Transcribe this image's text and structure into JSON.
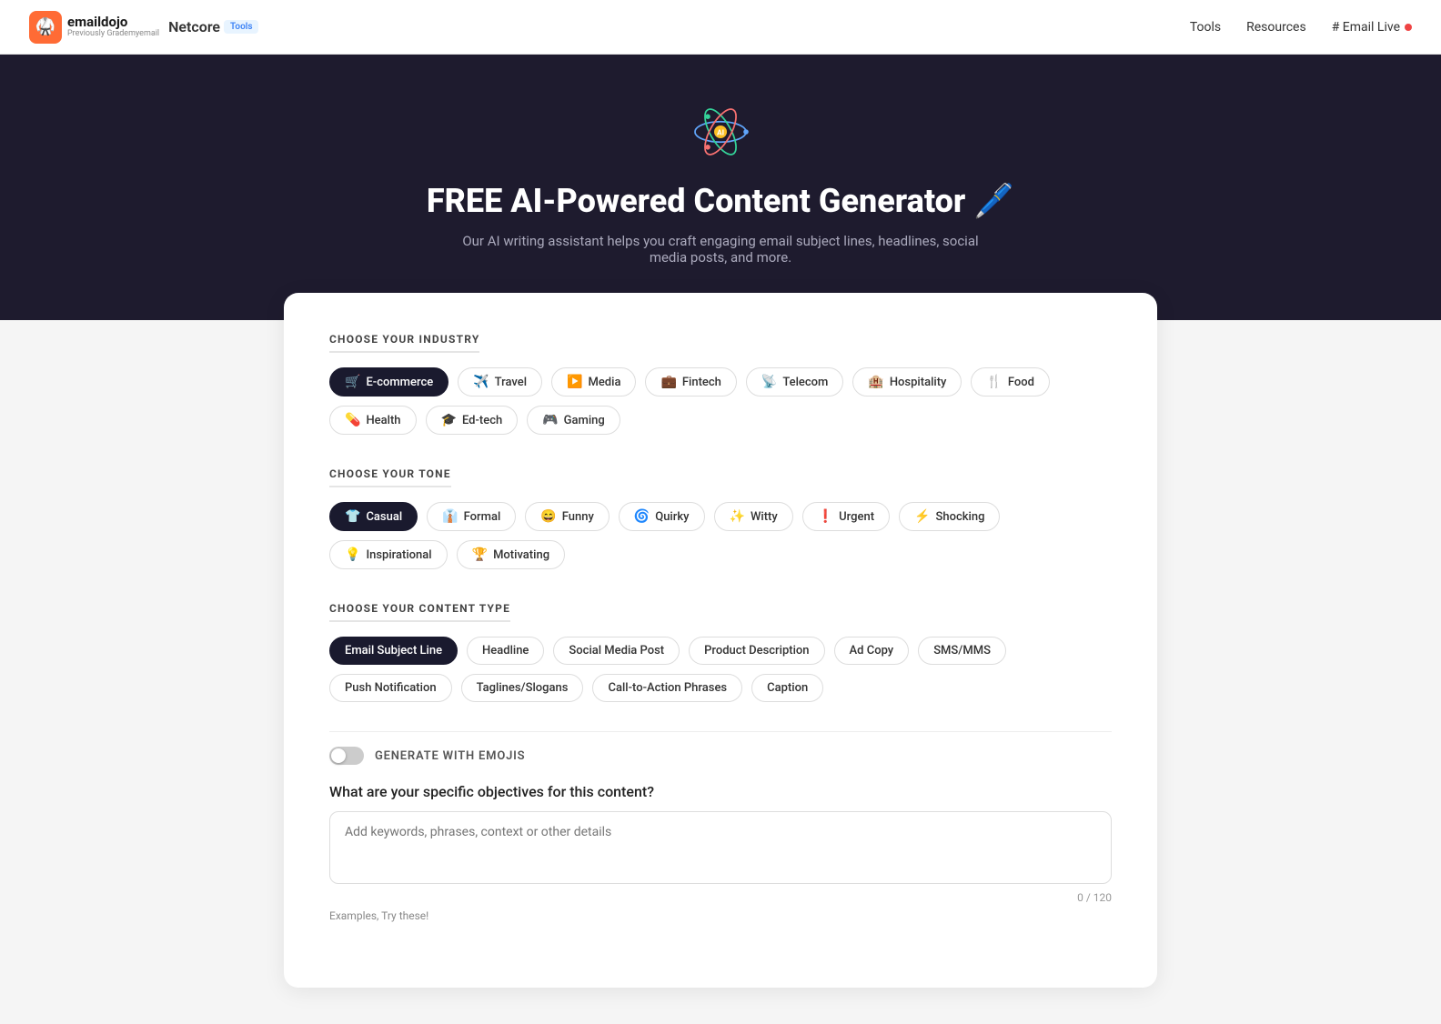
{
  "nav": {
    "logo_main": "emaildojo",
    "logo_sub": "Previously Grademyemail",
    "netcore_text": "Netcore",
    "tools_badge": "Tools",
    "links": [
      "Tools",
      "Resources"
    ],
    "email_live": "# Email Live"
  },
  "hero": {
    "title": "FREE AI-Powered Content Generator 🖊️",
    "subtitle": "Our AI writing assistant helps you craft engaging email subject lines, headlines, social media posts, and more."
  },
  "industry": {
    "label": "CHOOSE YOUR INDUSTRY",
    "items": [
      {
        "icon": "🛒",
        "label": "E-commerce",
        "active": true
      },
      {
        "icon": "✈️",
        "label": "Travel",
        "active": false
      },
      {
        "icon": "▶️",
        "label": "Media",
        "active": false
      },
      {
        "icon": "💼",
        "label": "Fintech",
        "active": false
      },
      {
        "icon": "📡",
        "label": "Telecom",
        "active": false
      },
      {
        "icon": "🏨",
        "label": "Hospitality",
        "active": false
      },
      {
        "icon": "🍴",
        "label": "Food",
        "active": false
      },
      {
        "icon": "💊",
        "label": "Health",
        "active": false
      },
      {
        "icon": "🎓",
        "label": "Ed-tech",
        "active": false
      },
      {
        "icon": "🎮",
        "label": "Gaming",
        "active": false
      }
    ]
  },
  "tone": {
    "label": "CHOOSE YOUR TONE",
    "items": [
      {
        "icon": "👕",
        "label": "Casual",
        "active": true
      },
      {
        "icon": "👔",
        "label": "Formal",
        "active": false
      },
      {
        "icon": "😄",
        "label": "Funny",
        "active": false
      },
      {
        "icon": "🌀",
        "label": "Quirky",
        "active": false
      },
      {
        "icon": "✨",
        "label": "Witty",
        "active": false
      },
      {
        "icon": "❗",
        "label": "Urgent",
        "active": false
      },
      {
        "icon": "⚡",
        "label": "Shocking",
        "active": false
      },
      {
        "icon": "💡",
        "label": "Inspirational",
        "active": false
      },
      {
        "icon": "🏆",
        "label": "Motivating",
        "active": false
      }
    ]
  },
  "content_type": {
    "label": "CHOOSE YOUR CONTENT TYPE",
    "items": [
      {
        "label": "Email Subject Line",
        "active": true
      },
      {
        "label": "Headline",
        "active": false
      },
      {
        "label": "Social Media Post",
        "active": false
      },
      {
        "label": "Product Description",
        "active": false
      },
      {
        "label": "Ad Copy",
        "active": false
      },
      {
        "label": "SMS/MMS",
        "active": false
      },
      {
        "label": "Push Notification",
        "active": false
      },
      {
        "label": "Taglines/Slogans",
        "active": false
      },
      {
        "label": "Call-to-Action Phrases",
        "active": false
      },
      {
        "label": "Caption",
        "active": false
      }
    ]
  },
  "emoji_toggle": {
    "label": "GENERATE WITH EMOJIS"
  },
  "objectives": {
    "question": "What are your specific objectives for this content?",
    "placeholder": "Add keywords, phrases, context or other details",
    "char_count": "0 / 120",
    "examples_label": "Examples, Try these!"
  }
}
